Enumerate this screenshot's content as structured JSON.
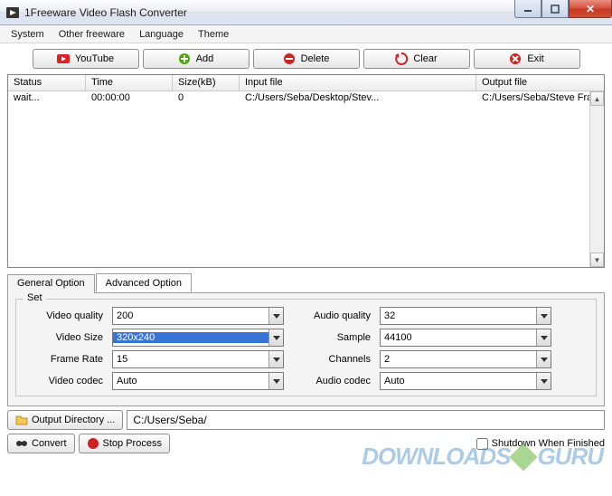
{
  "window": {
    "title": "1Freeware Video Flash Converter"
  },
  "menu": {
    "system": "System",
    "other": "Other freeware",
    "language": "Language",
    "theme": "Theme"
  },
  "toolbar": {
    "youtube": "YouTube",
    "add": "Add",
    "delete": "Delete",
    "clear": "Clear",
    "exit": "Exit"
  },
  "table": {
    "headers": {
      "status": "Status",
      "time": "Time",
      "size": "Size(kB)",
      "input": "Input file",
      "output": "Output file"
    },
    "rows": [
      {
        "status": "wait...",
        "time": "00:00:00",
        "size": "0",
        "input": "C:/Users/Seba/Desktop/Stev...",
        "output": "C:/Users/Seba/Steve Fran"
      }
    ]
  },
  "tabs": {
    "general": "General Option",
    "advanced": "Advanced Option"
  },
  "set": {
    "legend": "Set",
    "video_quality_lbl": "Video quality",
    "video_quality_val": "200",
    "audio_quality_lbl": "Audio quality",
    "audio_quality_val": "32",
    "video_size_lbl": "Video Size",
    "video_size_val": "320x240",
    "sample_lbl": "Sample",
    "sample_val": "44100",
    "frame_rate_lbl": "Frame Rate",
    "frame_rate_val": "15",
    "channels_lbl": "Channels",
    "channels_val": "2",
    "video_codec_lbl": "Video codec",
    "video_codec_val": "Auto",
    "audio_codec_lbl": "Audio codec",
    "audio_codec_val": "Auto"
  },
  "output": {
    "button": "Output Directory ...",
    "path": "C:/Users/Seba/"
  },
  "actions": {
    "convert": "Convert",
    "stop": "Stop Process",
    "shutdown": "Shutdown When Finished"
  },
  "watermark": {
    "a": "DOWNLOADS",
    "b": "GURU"
  }
}
